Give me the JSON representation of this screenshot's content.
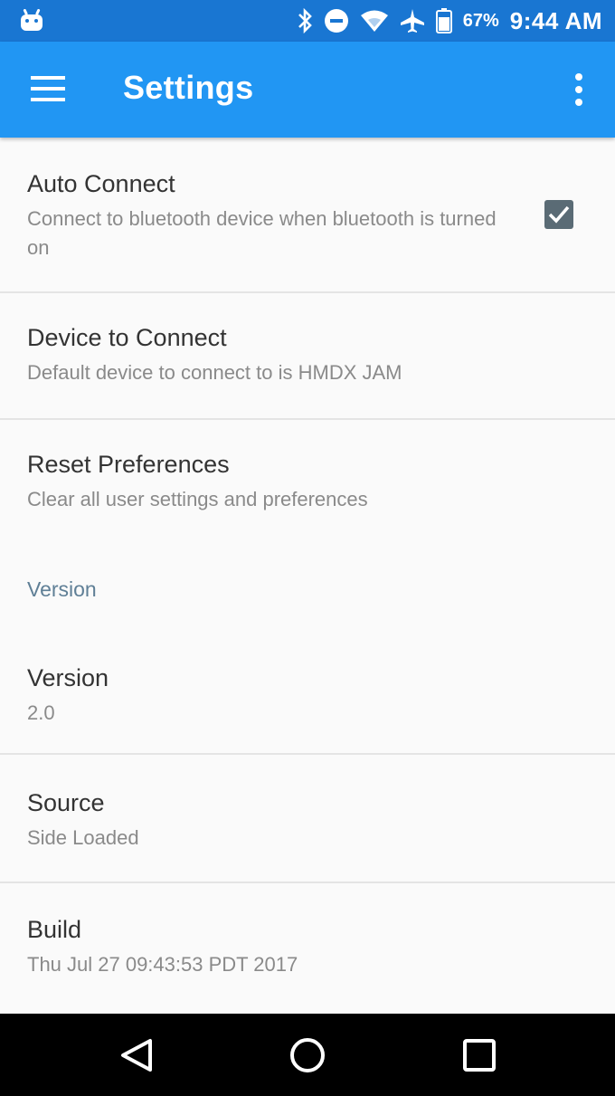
{
  "status_bar": {
    "battery_percent": "67%",
    "time": "9:44 AM",
    "icons": [
      "android-icon",
      "bluetooth-icon",
      "do-not-disturb-icon",
      "wifi-icon",
      "airplane-icon",
      "battery-icon"
    ]
  },
  "app_bar": {
    "title": "Settings",
    "menu_icon": "hamburger-menu-icon",
    "overflow_icon": "more-vert-icon"
  },
  "preferences": [
    {
      "title": "Auto Connect",
      "summary": "Connect to bluetooth device when bluetooth is turned on",
      "checked": true
    },
    {
      "title": "Device to Connect",
      "summary": "Default device to connect to is HMDX JAM"
    },
    {
      "title": "Reset Preferences",
      "summary": "Clear all user settings and preferences"
    }
  ],
  "version_category": {
    "label": "Version",
    "items": [
      {
        "title": "Version",
        "summary": "2.0"
      },
      {
        "title": "Source",
        "summary": "Side Loaded"
      },
      {
        "title": "Build",
        "summary": "Thu Jul 27 09:43:53 PDT 2017"
      }
    ]
  },
  "nav_bar": {
    "icons": [
      "back-icon",
      "home-icon",
      "recents-icon"
    ]
  },
  "colors": {
    "status_bar": "#1976d2",
    "app_bar": "#2196f3",
    "background": "#fafafa",
    "checkbox": "#5a6b75",
    "category_text": "#5f7f96"
  }
}
